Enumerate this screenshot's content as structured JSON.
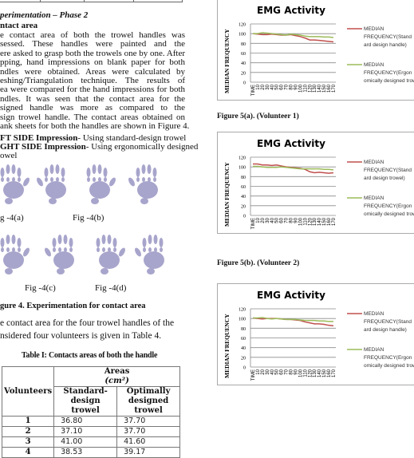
{
  "left": {
    "section_heading": "perimentation – Phase 2",
    "subheading": "ntact area",
    "paragraph_lines": [
      "e contact area of both the trowel handles was",
      "sessed. These handles were painted and the volunteers",
      "ere asked to grasp both the trowels one by one. After",
      "pping, hand impressions on blank paper for both",
      "ndles were obtained. Areas were calculated by",
      "eshing/Triangulation technique. The results of contact",
      "ea were compared for the hand impressions for both",
      "ndles. It was seen that the contact area for the",
      "signed handle was more as compared to the standard-",
      "sign trowel handle. The contact areas obtained on the",
      "ank sheets for both the handles are shown in Figure 4."
    ],
    "left_side": {
      "label": "FT SIDE Impression",
      "text": "- Using standard-design trowel"
    },
    "right_side": {
      "label": "GHT SIDE Impression",
      "text": "- Using ergonomically designed"
    },
    "right_side_cont": "owel",
    "fig_labels": [
      "g -4(a)",
      "Fig -4(b)",
      "Fig -4(c)",
      "Fig -4(d)"
    ],
    "figure4_caption": "gure 4. Experimentation for contact area",
    "para2_lines": [
      "e contact area for the four trowel handles of the",
      "nsidered four volunteers is given in Table 4."
    ],
    "table": {
      "caption": "Table I: Contacts areas of both the handle",
      "header_volunteers": "Volunteers",
      "header_areas": "Areas",
      "header_unit": "(cm²)",
      "header_standard": [
        "Standard-",
        "design",
        "trowel"
      ],
      "header_optimal": [
        "Optimally",
        "designed",
        "trowel"
      ],
      "rows": [
        {
          "volunteer": "1",
          "standard": "36.80",
          "optimal": "37.70"
        },
        {
          "volunteer": "2",
          "standard": "37.10",
          "optimal": "37.70"
        },
        {
          "volunteer": "3",
          "standard": "41.00",
          "optimal": "41.60"
        },
        {
          "volunteer": "4",
          "standard": "38.53",
          "optimal": "39.17"
        }
      ]
    },
    "handprint_color": "#9a96c4"
  },
  "right": {
    "captions": [
      "Figure 5(a). (Volunteer 1)",
      "Figure 5(b). (Volunteer 2)"
    ]
  },
  "chart_data": [
    {
      "type": "line",
      "title": "EMG Activity",
      "ylabel": "MEDIAN FREQUENCY",
      "xlabel": "",
      "ylim": [
        0,
        120
      ],
      "yticks": [
        "0",
        "20",
        "40",
        "60",
        "80",
        "100",
        "120"
      ],
      "categories": [
        "TIME",
        "10",
        "20",
        "30",
        "40",
        "50",
        "60",
        "70",
        "80",
        "90",
        "100",
        "110",
        "120",
        "130",
        "140",
        "150",
        "160",
        "170"
      ],
      "grid": true,
      "legend": "right",
      "series": [
        {
          "name": "MEDIAN FREQUENCY(Standard design handle)",
          "color": "#c0504d",
          "values": [
            100,
            99,
            98,
            98,
            99,
            98,
            97,
            97,
            98,
            96,
            94,
            91,
            87,
            87,
            86,
            85,
            84,
            83
          ]
        },
        {
          "name": "MEDIAN FREQUENCY(Ergonomically designed trowel)",
          "color": "#9bbb59",
          "values": [
            100,
            100,
            102,
            101,
            100,
            99,
            98,
            97,
            99,
            98,
            97,
            95,
            94,
            94,
            94,
            93,
            93,
            92
          ]
        }
      ]
    },
    {
      "type": "line",
      "title": "EMG Activity",
      "ylabel": "MEDIAN FREQUENCY",
      "xlabel": "",
      "ylim": [
        0,
        120
      ],
      "yticks": [
        "0",
        "20",
        "40",
        "60",
        "80",
        "100",
        "120"
      ],
      "categories": [
        "TIME",
        "10",
        "20",
        "30",
        "40",
        "50",
        "60",
        "70",
        "80",
        "90",
        "100",
        "110",
        "120",
        "130",
        "140",
        "150",
        "160",
        "170"
      ],
      "grid": true,
      "legend": "right",
      "series": [
        {
          "name": "MEDIAN FREQUENCY(Standard design trowel)",
          "color": "#c0504d",
          "values": [
            106,
            106,
            104,
            104,
            103,
            104,
            102,
            100,
            99,
            98,
            97,
            95,
            90,
            88,
            89,
            88,
            87,
            88
          ]
        },
        {
          "name": "MEDIAN FREQUENCY(Ergonomically designed trowel)",
          "color": "#9bbb59",
          "values": [
            101,
            101,
            100,
            99,
            99,
            99,
            100,
            99,
            98,
            97,
            96,
            96,
            96,
            96,
            96,
            95,
            95,
            94
          ]
        }
      ]
    },
    {
      "type": "line",
      "title": "EMG Activity",
      "ylabel": "MEDIAN FREQUENCY",
      "xlabel": "",
      "ylim": [
        0,
        120
      ],
      "yticks": [
        "0",
        "20",
        "40",
        "60",
        "80",
        "100",
        "120"
      ],
      "categories": [
        "TIME",
        "10",
        "20",
        "30",
        "40",
        "50",
        "60",
        "70",
        "80",
        "90",
        "100",
        "110",
        "120",
        "130",
        "140",
        "150",
        "160",
        "170"
      ],
      "grid": true,
      "legend": "right",
      "series": [
        {
          "name": "MEDIAN FREQUENCY(Standard design handle)",
          "color": "#c0504d",
          "values": [
            101,
            100,
            99,
            100,
            100,
            100,
            99,
            98,
            98,
            97,
            96,
            93,
            91,
            89,
            89,
            88,
            86,
            85
          ]
        },
        {
          "name": "MEDIAN FREQUENCY(Ergonomically designed trowel)",
          "color": "#9bbb59",
          "values": [
            101,
            101,
            102,
            100,
            99,
            100,
            99,
            98,
            98,
            98,
            97,
            96,
            96,
            96,
            95,
            95,
            94,
            94
          ]
        }
      ]
    }
  ]
}
